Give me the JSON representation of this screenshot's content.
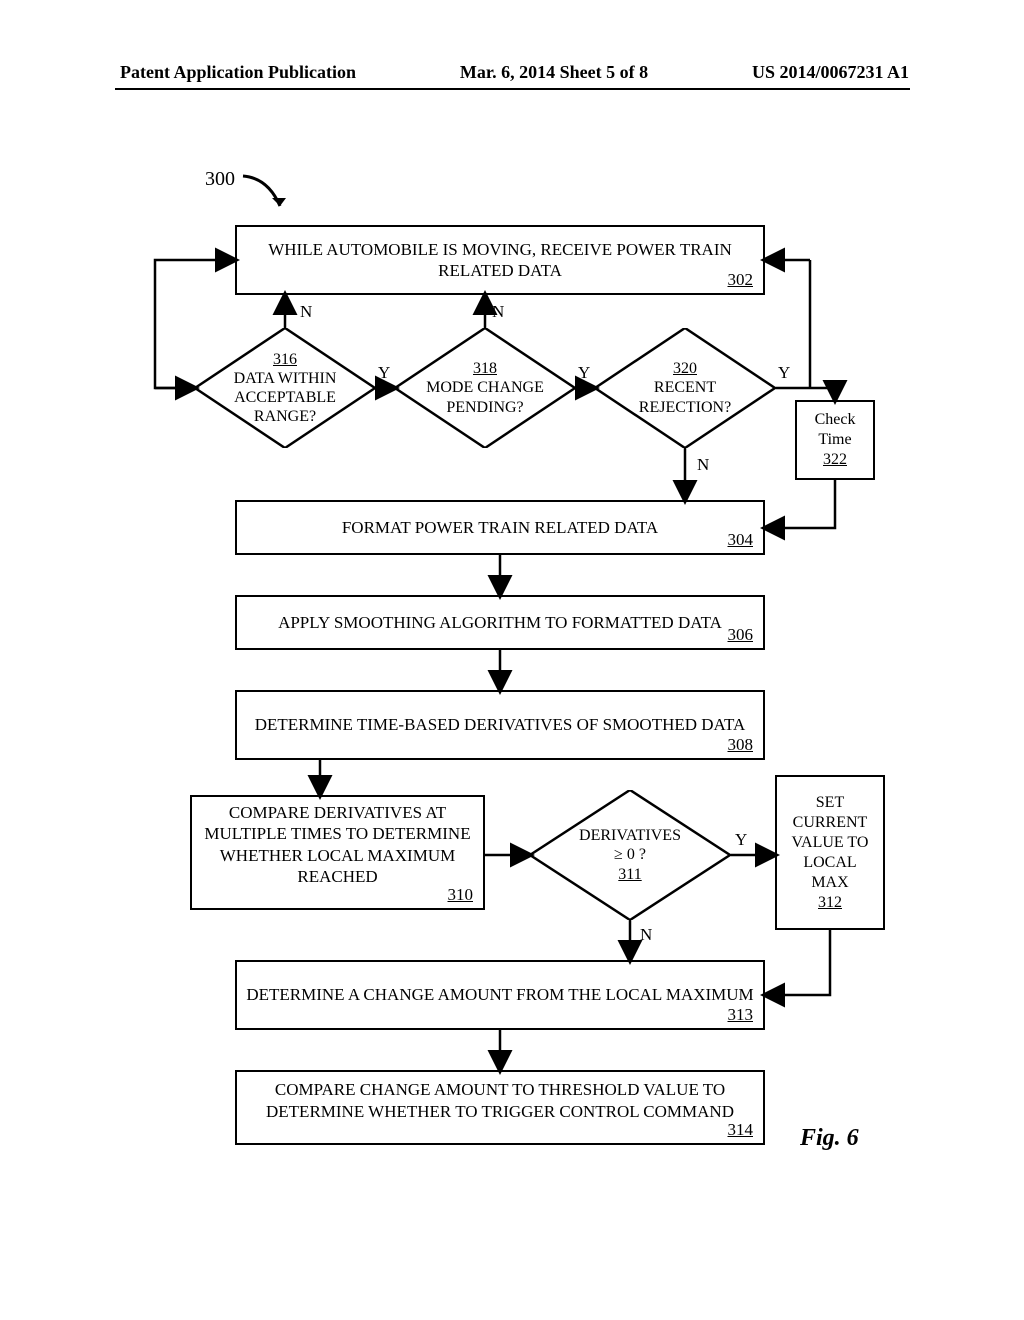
{
  "header": {
    "left": "Patent Application Publication",
    "center": "Mar. 6, 2014  Sheet 5 of 8",
    "right": "US 2014/0067231 A1"
  },
  "ref300": "300",
  "b302": {
    "text": "WHILE AUTOMOBILE IS MOVING, RECEIVE POWER TRAIN RELATED DATA",
    "num": "302"
  },
  "d316": {
    "text": "DATA WITHIN ACCEPTABLE RANGE?",
    "num": "316"
  },
  "d318": {
    "text": "MODE CHANGE PENDING?",
    "num": "318"
  },
  "d320": {
    "text": "RECENT REJECTION?",
    "num": "320"
  },
  "b322": {
    "l1": "Check",
    "l2": "Time",
    "num": "322"
  },
  "b304": {
    "text": "FORMAT POWER TRAIN RELATED DATA",
    "num": "304"
  },
  "b306": {
    "text": "APPLY SMOOTHING ALGORITHM TO FORMATTED DATA",
    "num": "306"
  },
  "b308": {
    "text": "DETERMINE TIME-BASED DERIVATIVES OF SMOOTHED DATA",
    "num": "308"
  },
  "b310": {
    "text": "COMPARE DERIVATIVES AT MULTIPLE TIMES TO DETERMINE WHETHER LOCAL MAXIMUM REACHED",
    "num": "310"
  },
  "d311": {
    "l1": "DERIVATIVES",
    "l2": "≥ 0 ?",
    "num": "311"
  },
  "b312": {
    "l1": "SET",
    "l2": "CURRENT",
    "l3": "VALUE TO",
    "l4": "LOCAL",
    "l5": "MAX",
    "num": "312"
  },
  "b313": {
    "text": "DETERMINE A CHANGE AMOUNT FROM THE LOCAL MAXIMUM",
    "num": "313"
  },
  "b314": {
    "text": "COMPARE CHANGE AMOUNT TO THRESHOLD VALUE TO DETERMINE WHETHER TO TRIGGER CONTROL COMMAND",
    "num": "314"
  },
  "labels": {
    "Y": "Y",
    "N": "N"
  },
  "figcaption": "Fig. 6"
}
